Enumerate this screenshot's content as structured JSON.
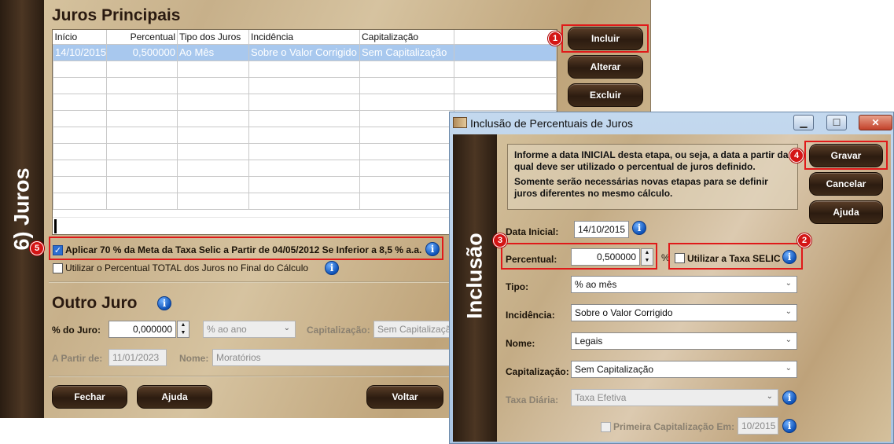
{
  "back_window": {
    "side_label": "6) Juros",
    "section_title": "Juros Principais",
    "table": {
      "columns": [
        "Início",
        "Percentual",
        "Tipo dos Juros",
        "Incidência",
        "Capitalização"
      ],
      "rows": [
        [
          "14/10/2015",
          "0,500000",
          "Ao Mês",
          "Sobre o Valor Corrigido",
          "Sem Capitalização"
        ]
      ]
    },
    "buttons": {
      "incluir": "Incluir",
      "alterar": "Alterar",
      "excluir": "Excluir"
    },
    "checkbox_selic": "Aplicar 70 % da Meta da Taxa Selic a Partir de 04/05/2012 Se Inferior a 8,5 % a.a.",
    "checkbox_total": "Utilizar o Percentual TOTAL dos Juros no Final do Cálculo",
    "outro_juro": {
      "title": "Outro Juro",
      "pct_label": "% do Juro:",
      "pct_value": "0,000000",
      "tipo_value": "% ao ano",
      "cap_label": "Capitalização:",
      "cap_value": "Sem Capitalização",
      "apartir_label": "A Partir de:",
      "apartir_value": "11/01/2023",
      "nome_label": "Nome:",
      "nome_value": "Moratórios"
    },
    "footer": {
      "fechar": "Fechar",
      "ajuda": "Ajuda",
      "voltar": "Voltar"
    }
  },
  "dialog": {
    "title": "Inclusão de Percentuais de Juros",
    "side_label": "Inclusão",
    "note_1": "Informe a data INICIAL desta etapa, ou seja, a data a partir da qual deve ser utilizado o percentual de juros definido.",
    "note_2": "Somente serão necessárias novas etapas para se definir juros diferentes no mesmo cálculo.",
    "buttons": {
      "gravar": "Gravar",
      "cancelar": "Cancelar",
      "ajuda": "Ajuda"
    },
    "data_inicial": {
      "label": "Data Inicial:",
      "value": "14/10/2015"
    },
    "percentual": {
      "label": "Percentual:",
      "value": "0,500000",
      "unit": "%"
    },
    "selic_checkbox": "Utilizar a Taxa SELIC",
    "tipo": {
      "label": "Tipo:",
      "value": "% ao mês"
    },
    "incidencia": {
      "label": "Incidência:",
      "value": "Sobre o Valor Corrigido"
    },
    "nome": {
      "label": "Nome:",
      "value": "Legais"
    },
    "capitalizacao": {
      "label": "Capitalização:",
      "value": "Sem Capitalização"
    },
    "taxa_diaria": {
      "label": "Taxa Diária:",
      "value": "Taxa Efetiva"
    },
    "primeira_cap": {
      "label": "Primeira Capitalização Em:",
      "value": "10/2015"
    }
  },
  "badges": [
    "1",
    "2",
    "3",
    "4",
    "5"
  ]
}
